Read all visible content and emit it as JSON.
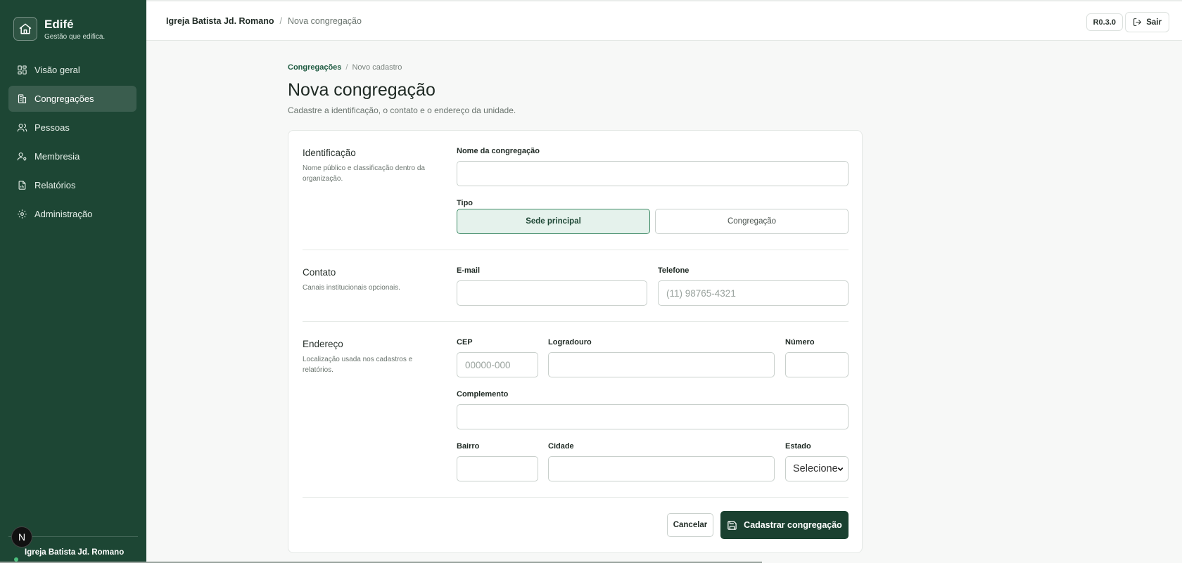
{
  "brand": {
    "name": "Edifé",
    "tagline": "Gestão que edifica."
  },
  "sidebar": {
    "items": [
      {
        "label": "Visão geral",
        "icon": "grid-icon",
        "active": false
      },
      {
        "label": "Congregações",
        "icon": "building-icon",
        "active": true
      },
      {
        "label": "Pessoas",
        "icon": "users-icon",
        "active": false
      },
      {
        "label": "Membresia",
        "icon": "user-key-icon",
        "active": false
      },
      {
        "label": "Relatórios",
        "icon": "report-icon",
        "active": false
      },
      {
        "label": "Administração",
        "icon": "gear-icon",
        "active": false
      }
    ],
    "org_name": "Igreja Batista Jd. Romano",
    "n_badge": "N"
  },
  "topbar": {
    "org": "Igreja Batista Jd. Romano",
    "separator": "/",
    "current": "Nova congregação",
    "version": "R0.3.0",
    "logout_label": "Sair"
  },
  "page": {
    "breadcrumb_link": "Congregações",
    "breadcrumb_sep": "/",
    "breadcrumb_current": "Novo cadastro",
    "title": "Nova congregação",
    "subtitle": "Cadastre a identificação, o contato e o endereço da unidade."
  },
  "form": {
    "identificacao": {
      "title": "Identificação",
      "desc": "Nome público e classificação dentro da organização.",
      "nome_label": "Nome da congregação",
      "nome_value": "",
      "tipo_label": "Tipo",
      "tipo_options": [
        "Sede principal",
        "Congregação"
      ],
      "tipo_selected": "Sede principal"
    },
    "contato": {
      "title": "Contato",
      "desc": "Canais institucionais opcionais.",
      "email_label": "E-mail",
      "email_value": "",
      "telefone_label": "Telefone",
      "telefone_placeholder": "(11) 98765-4321"
    },
    "endereco": {
      "title": "Endereço",
      "desc": "Localização usada nos cadastros e relatórios.",
      "cep_label": "CEP",
      "cep_placeholder": "00000-000",
      "logradouro_label": "Logradouro",
      "numero_label": "Número",
      "complemento_label": "Complemento",
      "bairro_label": "Bairro",
      "cidade_label": "Cidade",
      "estado_label": "Estado",
      "estado_value": "Selecione"
    },
    "actions": {
      "cancel_label": "Cancelar",
      "submit_label": "Cadastrar congregação"
    }
  },
  "colors": {
    "sidebar_bg": "#1d4634",
    "primary_button": "#1a4030",
    "accent_link": "#1d5a40",
    "selected_bg": "#e5f2ec"
  }
}
